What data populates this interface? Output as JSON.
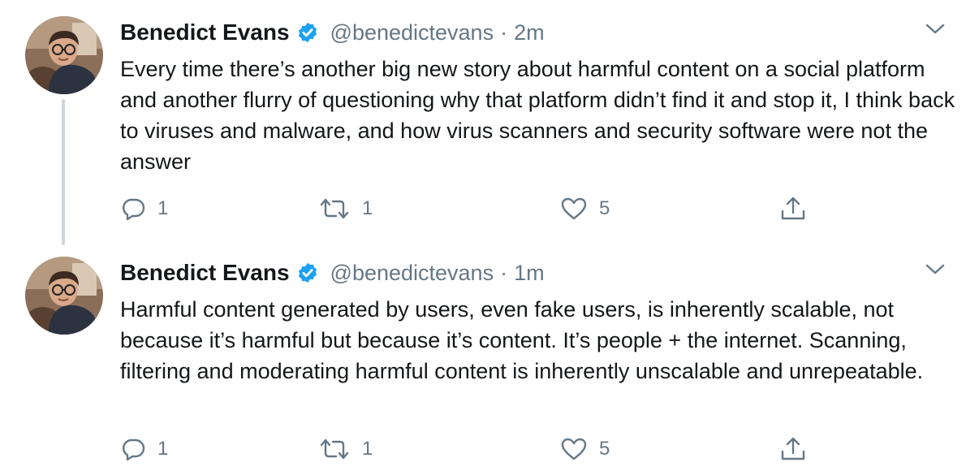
{
  "colors": {
    "text": "#14171a",
    "secondary": "#657786",
    "verified": "#1da1f2",
    "thread_line": "#cdd5dc"
  },
  "icons": {
    "verified": "verified-badge-icon",
    "menu": "chevron-down-icon",
    "reply": "reply-icon",
    "retweet": "retweet-icon",
    "like": "heart-icon",
    "share": "share-icon"
  },
  "tweets": [
    {
      "author": "Benedict Evans",
      "handle": "@benedictevans",
      "separator": "·",
      "time": "2m",
      "text": "Every time there’s another big new story about harmful content on a social platform and another flurry of questioning why that platform didn’t find it and stop it, I think back to viruses and malware, and how virus scanners and security software were not the answer",
      "replies": "1",
      "retweets": "1",
      "likes": "5"
    },
    {
      "author": "Benedict Evans",
      "handle": "@benedictevans",
      "separator": "·",
      "time": "1m",
      "text": "Harmful content generated by users, even fake users, is inherently scalable, not because it’s harmful but because it’s content. It’s people + the internet. Scanning, filtering and moderating harmful content is inherently unscalable and unrepeatable.",
      "replies": "1",
      "retweets": "1",
      "likes": "5"
    }
  ]
}
